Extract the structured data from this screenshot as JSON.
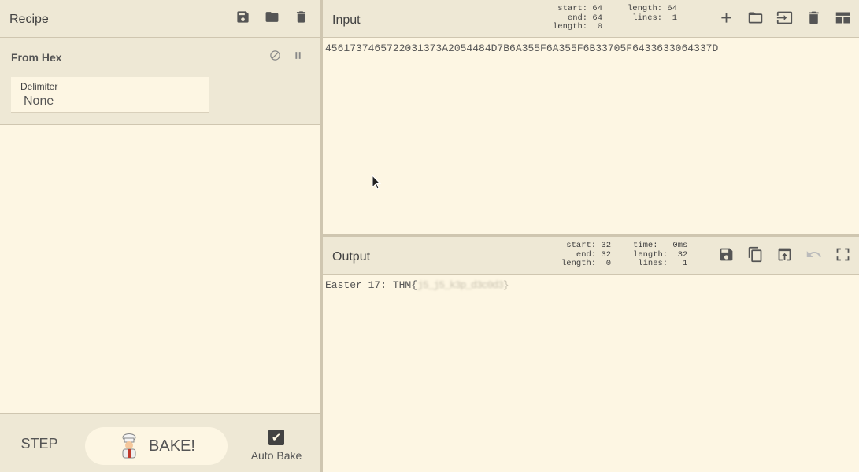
{
  "recipe": {
    "title": "Recipe",
    "icons": [
      "save-icon",
      "folder-icon",
      "trash-icon"
    ],
    "operation": {
      "name": "From Hex",
      "delimiter_label": "Delimiter",
      "delimiter_value": "None"
    },
    "step_label": "STEP",
    "bake_label": "BAKE!",
    "autobake_label": "Auto Bake",
    "autobake_checked": true
  },
  "input": {
    "title": "Input",
    "stats": {
      "start_label": "start:",
      "start": "64",
      "end_label": "end:",
      "end": "64",
      "length_label": "length:",
      "length": "0",
      "total_length_label": "length:",
      "total_length": "64",
      "lines_label": "lines:",
      "lines": "1"
    },
    "value": "456173746572203137 3A2054484D7B6A355F6A355F6B33705F6433633064337D"
  },
  "output": {
    "title": "Output",
    "stats": {
      "start_label": "start:",
      "start": "32",
      "end_label": "end:",
      "end": "32",
      "length_label": "length:",
      "length": "0",
      "time_label": "time:",
      "time": "0ms",
      "total_length_label": "length:",
      "total_length": "32",
      "lines_label": "lines:",
      "lines": "1"
    },
    "prefix": "Easter 17: THM{",
    "redacted": "j5_j5_k3p_d3c0d3",
    "suffix": "}"
  },
  "colors": {
    "background": "#fdf6e3",
    "panel": "#eee8d5",
    "border": "#cfc6b0",
    "text": "#424242"
  }
}
